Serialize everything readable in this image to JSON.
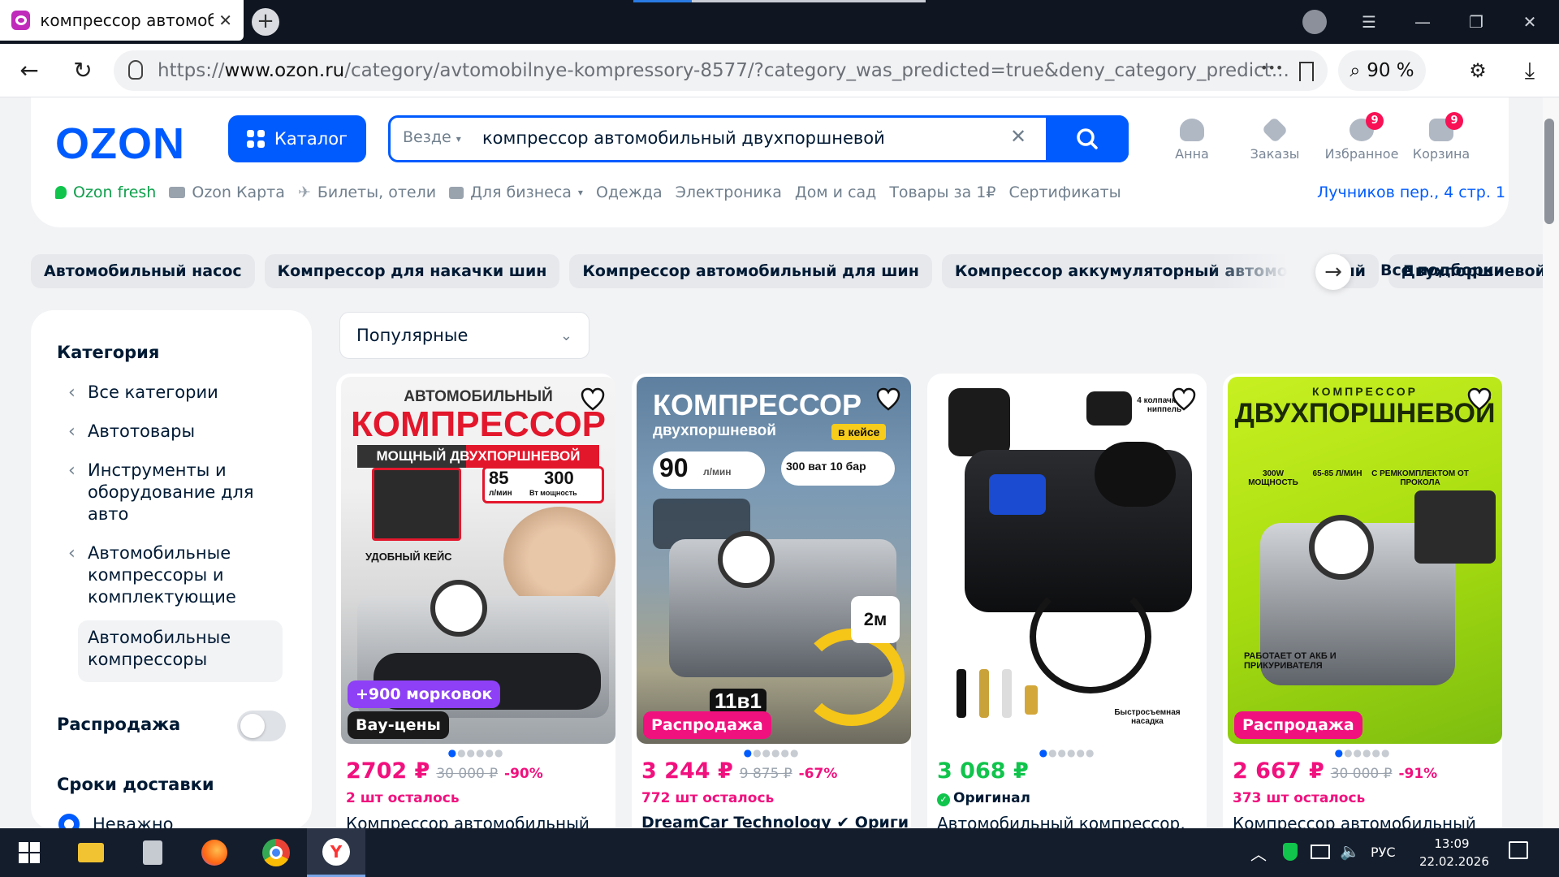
{
  "browser": {
    "tab_title": "компрессор автомобильный двухпоршневой",
    "tab_close": "✕",
    "new_tab": "+",
    "url_prefix": "https://",
    "url_host": "www.ozon.ru",
    "url_path": "/category/avtomobilnye-kompressory-8577/?category_was_predicted=true&deny_category_predict...",
    "zoom": "90 %",
    "more": "•••"
  },
  "header": {
    "logo": "OZON",
    "catalog_label": "Каталог",
    "search_scope": "Везде",
    "search_query": "компрессор автомобильный двухпоршневой",
    "clear": "✕",
    "icons": [
      {
        "label": "Анна"
      },
      {
        "label": "Заказы"
      },
      {
        "label": "Избранное",
        "badge": "9"
      },
      {
        "label": "Корзина",
        "badge": "9"
      }
    ],
    "links": [
      "Ozon fresh",
      "Ozon Карта",
      "Билеты, отели",
      "Для бизнеса",
      "Одежда",
      "Электроника",
      "Дом и сад",
      "Товары за 1₽",
      "Сертификаты"
    ],
    "address": "Лучников пер., 4 стр. 1"
  },
  "chips": [
    "Автомобильный насос",
    "Компрессор для накачки шин",
    "Компрессор автомобильный для шин",
    "Компрессор аккумуляторный автомобильный",
    "Двухпоршневой"
  ],
  "chips_all": "Все подборки",
  "sidebar": {
    "category_title": "Категория",
    "categories": [
      "Все категории",
      "Автотовары",
      "Инструменты и оборудование для авто",
      "Автомобильные компрессоры и комплектующие",
      "Автомобильные компрессоры"
    ],
    "sale_label": "Распродажа",
    "delivery_title": "Сроки доставки",
    "delivery_option": "Неважно"
  },
  "sort": {
    "selected": "Популярные"
  },
  "products": [
    {
      "price": "2702 ₽",
      "old_price": "30 000 ₽",
      "discount": "-90%",
      "stock": "2 шт осталось",
      "name": "Компрессор автомобильный",
      "tag1": "+900 морковок",
      "tag2": "Вау-цены",
      "img_title1": "АВТОМОБИЛЬНЫЙ",
      "img_title2": "КОМПРЕССОР",
      "img_sub": "МОЩНЫЙ ДВУХПОРШНЕВОЙ",
      "img_spec1": "85",
      "img_spec1u": "л/мин",
      "img_spec2": "300",
      "img_spec2u": "Вт мощность",
      "img_case": "УДОБНЫЙ КЕЙС"
    },
    {
      "price": "3 244 ₽",
      "old_price": "9 875 ₽",
      "discount": "-67%",
      "stock": "772 шт осталось",
      "name": "DreamCar Technology ✔ Оригин...",
      "tag1": "Распродажа",
      "img_title1": "КОМПРЕССОР",
      "img_sub": "двухпоршневой",
      "img_badge": "в кейсе",
      "img_spec1": "90",
      "img_spec1u": "л/мин",
      "img_spec2": "300 ват 10 бар",
      "img_hose": "2м",
      "img_11": "11в1"
    },
    {
      "price": "3 068 ₽",
      "stock": "Оригинал",
      "name": "Автомобильный компрессор,",
      "img_caps": "4 колпачка на ниппель",
      "img_nozzle": "Быстросъемная насадка"
    },
    {
      "price": "2 667 ₽",
      "old_price": "30 000 ₽",
      "discount": "-91%",
      "stock": "373 шт осталось",
      "name": "Компрессор автомобильный",
      "tag1": "Распродажа",
      "img_title1": "КОМПРЕССОР",
      "img_title2": "ДВУХПОРШНЕВОЙ",
      "img_f1": "300W МОЩНОСТЬ",
      "img_f2": "65-85 Л/МИН",
      "img_f3": "С РЕМКОМПЛЕКТОМ ОТ ПРОКОЛА",
      "img_works": "РАБОТАЕТ ОТ АКБ И ПРИКУРИВАТЕЛЯ"
    }
  ],
  "taskbar": {
    "lang": "РУС",
    "time": "13:09",
    "date": "22.02.2026"
  },
  "colors": {
    "brand": "#005bff",
    "price": "#f1117e",
    "price_green": "#10c44c"
  }
}
